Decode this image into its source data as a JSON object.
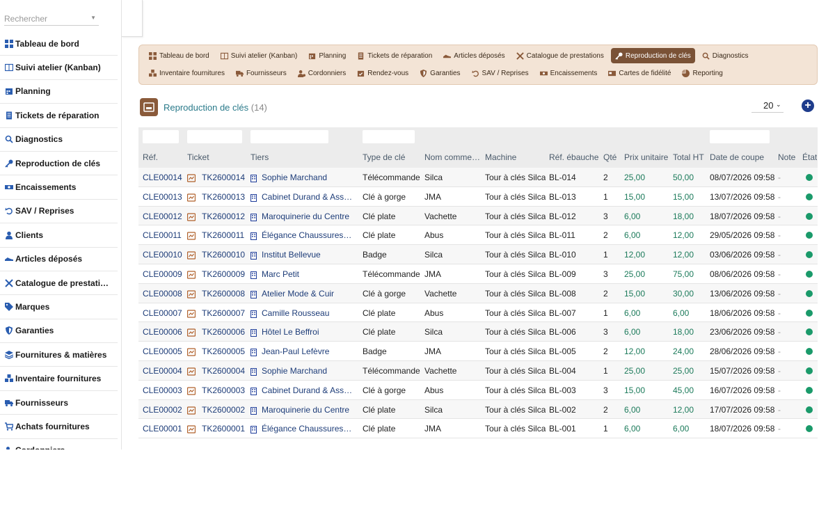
{
  "search": {
    "placeholder": "Rechercher"
  },
  "sidebar": {
    "items": [
      {
        "label": "Tableau de bord",
        "icon": "dashboard-icon"
      },
      {
        "label": "Suivi atelier (Kanban)",
        "icon": "kanban-icon"
      },
      {
        "label": "Planning",
        "icon": "calendar-icon"
      },
      {
        "label": "Tickets de réparation",
        "icon": "ticket-icon"
      },
      {
        "label": "Diagnostics",
        "icon": "magnifier-icon"
      },
      {
        "label": "Reproduction de clés",
        "icon": "key-icon"
      },
      {
        "label": "Encaissements",
        "icon": "cash-icon"
      },
      {
        "label": "SAV / Reprises",
        "icon": "undo-icon"
      },
      {
        "label": "Clients",
        "icon": "user-icon"
      },
      {
        "label": "Articles déposés",
        "icon": "shoe-icon"
      },
      {
        "label": "Catalogue de prestations",
        "icon": "tools-icon"
      },
      {
        "label": "Marques",
        "icon": "tag-icon"
      },
      {
        "label": "Garanties",
        "icon": "shield-icon"
      },
      {
        "label": "Fournitures & matières",
        "icon": "layers-icon"
      },
      {
        "label": "Inventaire fournitures",
        "icon": "boxes-icon"
      },
      {
        "label": "Fournisseurs",
        "icon": "truck-icon"
      },
      {
        "label": "Achats fournitures",
        "icon": "cart-icon"
      },
      {
        "label": "Cordonniers",
        "icon": "worker-icon"
      }
    ]
  },
  "topnav": {
    "row1": [
      {
        "label": "Tableau de bord",
        "icon": "dashboard-icon",
        "active": false
      },
      {
        "label": "Suivi atelier (Kanban)",
        "icon": "kanban-icon",
        "active": false
      },
      {
        "label": "Planning",
        "icon": "calendar-icon",
        "active": false
      },
      {
        "label": "Tickets de réparation",
        "icon": "ticket-icon",
        "active": false
      },
      {
        "label": "Articles déposés",
        "icon": "shoe-icon",
        "active": false
      },
      {
        "label": "Catalogue de prestations",
        "icon": "tools-icon",
        "active": false
      },
      {
        "label": "Reproduction de clés",
        "icon": "key-icon",
        "active": true
      },
      {
        "label": "Diagnostics",
        "icon": "magnifier-icon",
        "active": false
      }
    ],
    "row2": [
      {
        "label": "Inventaire fournitures",
        "icon": "boxes-icon"
      },
      {
        "label": "Fournisseurs",
        "icon": "truck-icon"
      },
      {
        "label": "Cordonniers",
        "icon": "worker-icon"
      },
      {
        "label": "Rendez-vous",
        "icon": "calendar-check-icon"
      },
      {
        "label": "Garanties",
        "icon": "shield-icon"
      },
      {
        "label": "SAV / Reprises",
        "icon": "undo-icon"
      },
      {
        "label": "Encaissements",
        "icon": "cash-icon"
      },
      {
        "label": "Cartes de fidélité",
        "icon": "card-icon"
      },
      {
        "label": "Reporting",
        "icon": "pie-icon"
      }
    ]
  },
  "header": {
    "title": "Reproduction de clés",
    "count": "(14)"
  },
  "pagination": {
    "page_size": "20"
  },
  "add_button": {
    "label": "+"
  },
  "table": {
    "columns": [
      "Réf.",
      "Ticket",
      "Tiers",
      "Type de clé",
      "Nom comme…",
      "Machine",
      "Réf. ébauche",
      "Qté",
      "Prix unitaire",
      "Total HT",
      "Date de coupe",
      "Note",
      "État"
    ],
    "rows": [
      {
        "ref": "CLE00014",
        "ticket": "TK2600014",
        "tiers": "Sophie Marchand",
        "type": "Télécommande",
        "nom": "Silca",
        "machine": "Tour à clés Silca",
        "ebauche": "BL-014",
        "qte": "2",
        "pu": "25,00",
        "total": "50,00",
        "date": "08/07/2026 09:58",
        "note": "-"
      },
      {
        "ref": "CLE00013",
        "ticket": "TK2600013",
        "tiers": "Cabinet Durand & Associés",
        "type": "Clé à gorge",
        "nom": "JMA",
        "machine": "Tour à clés Silca",
        "ebauche": "BL-013",
        "qte": "1",
        "pu": "15,00",
        "total": "15,00",
        "date": "13/07/2026 09:58",
        "note": "-"
      },
      {
        "ref": "CLE00012",
        "ticket": "TK2600012",
        "tiers": "Maroquinerie du Centre",
        "type": "Clé plate",
        "nom": "Vachette",
        "machine": "Tour à clés Silca",
        "ebauche": "BL-012",
        "qte": "3",
        "pu": "6,00",
        "total": "18,00",
        "date": "18/07/2026 09:58",
        "note": "-"
      },
      {
        "ref": "CLE00011",
        "ticket": "TK2600011",
        "tiers": "Élégance Chaussures Sarl",
        "type": "Clé plate",
        "nom": "Abus",
        "machine": "Tour à clés Silca",
        "ebauche": "BL-011",
        "qte": "2",
        "pu": "6,00",
        "total": "12,00",
        "date": "29/05/2026 09:58",
        "note": "-"
      },
      {
        "ref": "CLE00010",
        "ticket": "TK2600010",
        "tiers": "Institut Bellevue",
        "type": "Badge",
        "nom": "Silca",
        "machine": "Tour à clés Silca",
        "ebauche": "BL-010",
        "qte": "1",
        "pu": "12,00",
        "total": "12,00",
        "date": "03/06/2026 09:58",
        "note": "-"
      },
      {
        "ref": "CLE00009",
        "ticket": "TK2600009",
        "tiers": "Marc Petit",
        "type": "Télécommande",
        "nom": "JMA",
        "machine": "Tour à clés Silca",
        "ebauche": "BL-009",
        "qte": "3",
        "pu": "25,00",
        "total": "75,00",
        "date": "08/06/2026 09:58",
        "note": "-"
      },
      {
        "ref": "CLE00008",
        "ticket": "TK2600008",
        "tiers": "Atelier Mode & Cuir",
        "type": "Clé à gorge",
        "nom": "Vachette",
        "machine": "Tour à clés Silca",
        "ebauche": "BL-008",
        "qte": "2",
        "pu": "15,00",
        "total": "30,00",
        "date": "13/06/2026 09:58",
        "note": "-"
      },
      {
        "ref": "CLE00007",
        "ticket": "TK2600007",
        "tiers": "Camille Rousseau",
        "type": "Clé plate",
        "nom": "Abus",
        "machine": "Tour à clés Silca",
        "ebauche": "BL-007",
        "qte": "1",
        "pu": "6,00",
        "total": "6,00",
        "date": "18/06/2026 09:58",
        "note": "-"
      },
      {
        "ref": "CLE00006",
        "ticket": "TK2600006",
        "tiers": "Hôtel Le Beffroi",
        "type": "Clé plate",
        "nom": "Silca",
        "machine": "Tour à clés Silca",
        "ebauche": "BL-006",
        "qte": "3",
        "pu": "6,00",
        "total": "18,00",
        "date": "23/06/2026 09:58",
        "note": "-"
      },
      {
        "ref": "CLE00005",
        "ticket": "TK2600005",
        "tiers": "Jean-Paul Lefèvre",
        "type": "Badge",
        "nom": "JMA",
        "machine": "Tour à clés Silca",
        "ebauche": "BL-005",
        "qte": "2",
        "pu": "12,00",
        "total": "24,00",
        "date": "28/06/2026 09:58",
        "note": "-"
      },
      {
        "ref": "CLE00004",
        "ticket": "TK2600004",
        "tiers": "Sophie Marchand",
        "type": "Télécommande",
        "nom": "Vachette",
        "machine": "Tour à clés Silca",
        "ebauche": "BL-004",
        "qte": "1",
        "pu": "25,00",
        "total": "25,00",
        "date": "15/07/2026 09:58",
        "note": "-"
      },
      {
        "ref": "CLE00003",
        "ticket": "TK2600003",
        "tiers": "Cabinet Durand & Associés",
        "type": "Clé à gorge",
        "nom": "Abus",
        "machine": "Tour à clés Silca",
        "ebauche": "BL-003",
        "qte": "3",
        "pu": "15,00",
        "total": "45,00",
        "date": "16/07/2026 09:58",
        "note": "-"
      },
      {
        "ref": "CLE00002",
        "ticket": "TK2600002",
        "tiers": "Maroquinerie du Centre",
        "type": "Clé plate",
        "nom": "Silca",
        "machine": "Tour à clés Silca",
        "ebauche": "BL-002",
        "qte": "2",
        "pu": "6,00",
        "total": "12,00",
        "date": "17/07/2026 09:58",
        "note": "-"
      },
      {
        "ref": "CLE00001",
        "ticket": "TK2600001",
        "tiers": "Élégance Chaussures Sarl",
        "type": "Clé plate",
        "nom": "JMA",
        "machine": "Tour à clés Silca",
        "ebauche": "BL-001",
        "qte": "1",
        "pu": "6,00",
        "total": "6,00",
        "date": "18/07/2026 09:58",
        "note": "-"
      }
    ]
  },
  "colors": {
    "accent": "#7a5236",
    "nav_bg": "#f3e4d6",
    "link": "#1d3c78",
    "amount": "#1b7a5a",
    "state_ok": "#1a9a6a",
    "title": "#2a7a8a"
  }
}
